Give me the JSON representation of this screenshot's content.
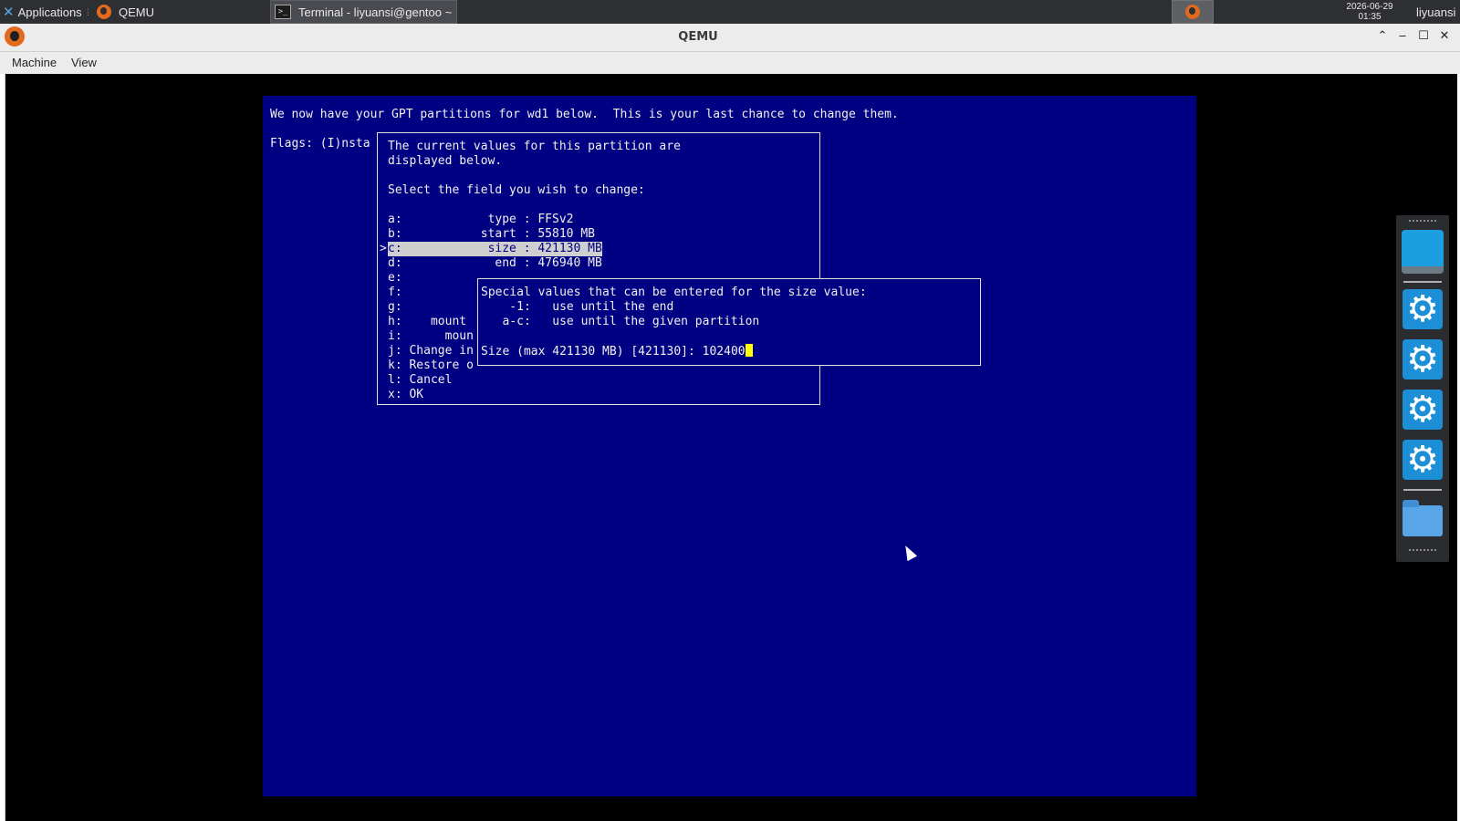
{
  "panel": {
    "applications_label": "Applications",
    "taskbar": [
      {
        "label": "QEMU"
      },
      {
        "label": "Terminal - liyuansi@gentoo ~"
      }
    ],
    "clock_date": "2026-06-29",
    "clock_time": "01:35",
    "user": "liyuansi"
  },
  "window": {
    "title": "QEMU",
    "menu": [
      "Machine",
      "View"
    ]
  },
  "console": {
    "header": "We now have your GPT partitions for wd1 below.  This is your last chance to change them.",
    "flags_fragment": "Flags: (I)nsta",
    "edit_dialog": {
      "intro_line1": "The current values for this partition are",
      "intro_line2": "displayed below.",
      "prompt": "Select the field you wish to change:",
      "rows": [
        "a:            type : FFSv2",
        "b:           start : 55810 MB",
        "c:            size : 421130 MB",
        "d:             end : 476940 MB",
        "e:",
        "f:",
        "g:",
        "h:    mount",
        "i:      moun",
        "j: Change in",
        "k: Restore o",
        "l: Cancel",
        "x: OK"
      ],
      "selected_marker": ">"
    },
    "size_dialog": {
      "line1": "Special values that can be entered for the size value:",
      "line2": "    -1:   use until the end",
      "line3": "   a-c:   use until the given partition",
      "input_prompt": "Size (max 421130 MB) [421130]: ",
      "input_value": "102400"
    }
  },
  "dock": {
    "icons": [
      "desktop-icon",
      "settings-icon",
      "settings-icon",
      "settings-icon",
      "settings-icon",
      "folder-icon"
    ]
  },
  "colors": {
    "console_bg": "#000082",
    "panel_bg": "#2e2f33",
    "dock_accent": "#1c8fd6"
  }
}
